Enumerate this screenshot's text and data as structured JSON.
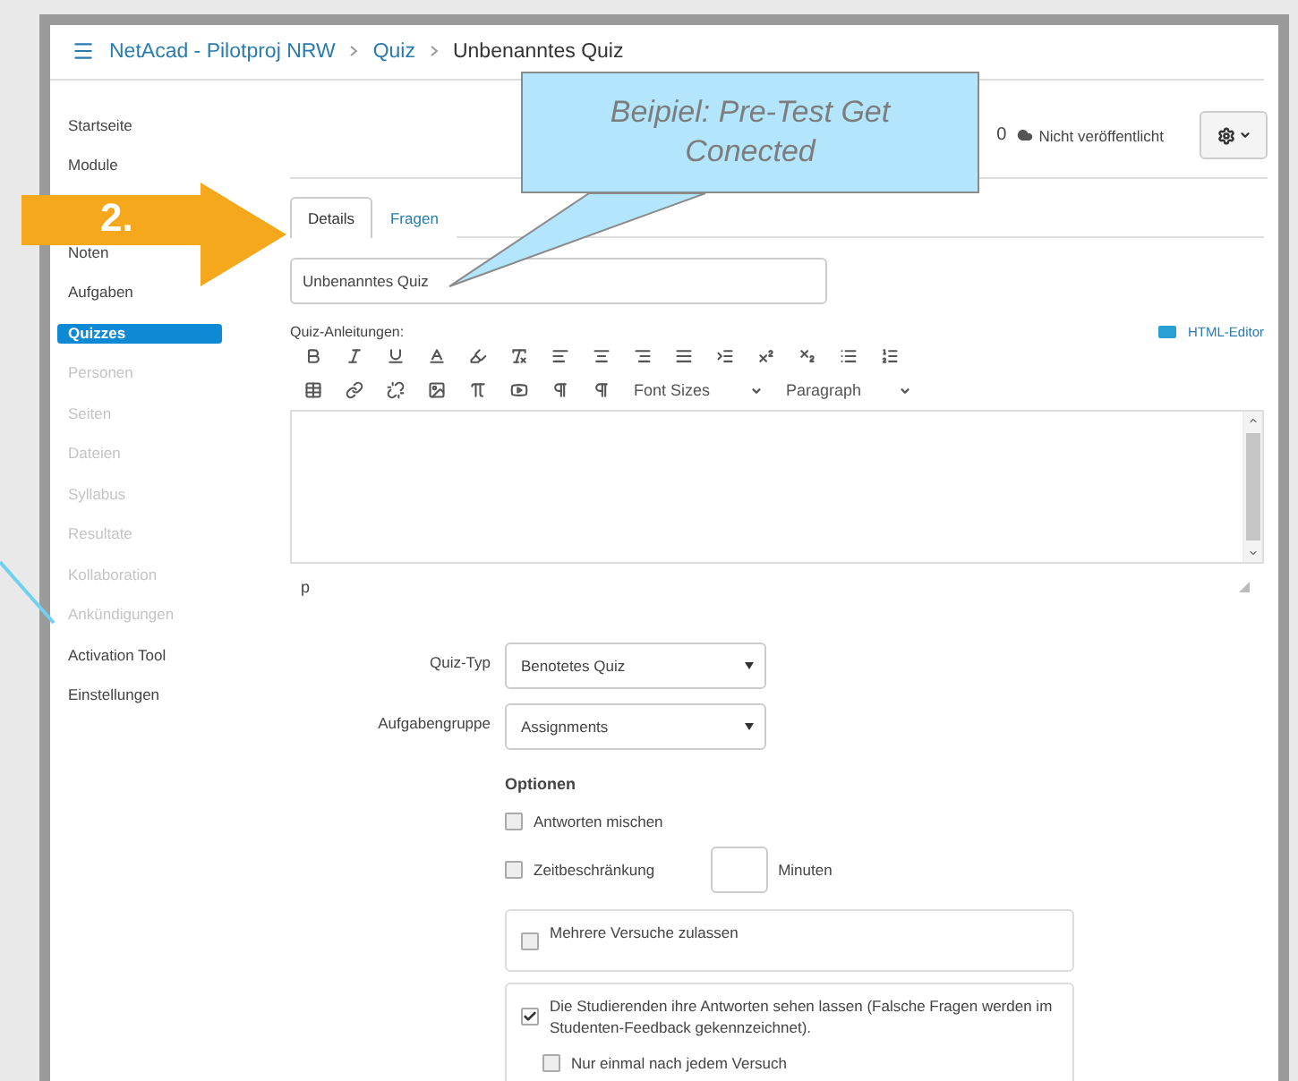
{
  "breadcrumb": [
    {
      "label": "NetAcad - Pilotproj NRW",
      "link": true
    },
    {
      "label": "Quiz",
      "link": true
    },
    {
      "label": "Unbenanntes Quiz",
      "link": false
    }
  ],
  "sidebar": {
    "items": [
      {
        "label": "Startseite",
        "selected": false,
        "disabled": false
      },
      {
        "label": "Module",
        "selected": false,
        "disabled": false
      },
      {
        "label": "Noten",
        "selected": false,
        "disabled": false,
        "gap_before": true
      },
      {
        "label": "Aufgaben",
        "selected": false,
        "disabled": false
      },
      {
        "label": "Quizzes",
        "selected": true,
        "disabled": false
      },
      {
        "label": "Personen",
        "selected": false,
        "disabled": true
      },
      {
        "label": "Seiten",
        "selected": false,
        "disabled": true
      },
      {
        "label": "Dateien",
        "selected": false,
        "disabled": true
      },
      {
        "label": "Syllabus",
        "selected": false,
        "disabled": true
      },
      {
        "label": "Resultate",
        "selected": false,
        "disabled": true
      },
      {
        "label": "Kollaboration",
        "selected": false,
        "disabled": true
      },
      {
        "label": "Ankündigungen",
        "selected": false,
        "disabled": true
      },
      {
        "label": "Activation Tool",
        "selected": false,
        "disabled": false
      },
      {
        "label": "Einstellungen",
        "selected": false,
        "disabled": false
      }
    ]
  },
  "header_actions": {
    "points": "0",
    "status": "Nicht veröffentlicht"
  },
  "tabs": [
    {
      "label": "Details",
      "selected": true
    },
    {
      "label": "Fragen",
      "selected": false
    }
  ],
  "title_field": {
    "value": "Unbenanntes Quiz"
  },
  "editor": {
    "label": "Quiz-Anleitungen:",
    "html_editor_link": "HTML-Editor",
    "font_sizes": "Font Sizes",
    "paragraph": "Paragraph",
    "path": "p"
  },
  "selects": [
    {
      "label": "Quiz-Typ",
      "value": "Benotetes Quiz"
    },
    {
      "label": "Aufgabengruppe",
      "value": "Assignments"
    }
  ],
  "options": {
    "heading": "Optionen",
    "items": [
      {
        "kind": "plain",
        "label": "Antworten mischen",
        "checked": false
      },
      {
        "kind": "timed",
        "label": "Zeitbeschränkung",
        "checked": false,
        "unit": "Minuten"
      },
      {
        "kind": "boxed",
        "label": "Mehrere Versuche zulassen",
        "checked": false
      },
      {
        "kind": "boxed",
        "label": "Die Studierenden ihre Antworten sehen lassen (Falsche Fragen werden im Studenten-Feedback gekennzeichnet).",
        "checked": true,
        "children": [
          {
            "label": "Nur einmal nach jedem Versuch",
            "checked": false
          }
        ]
      }
    ]
  },
  "annotation": {
    "step": "2.",
    "callout": "Beipiel: Pre-Test Get Conected"
  }
}
